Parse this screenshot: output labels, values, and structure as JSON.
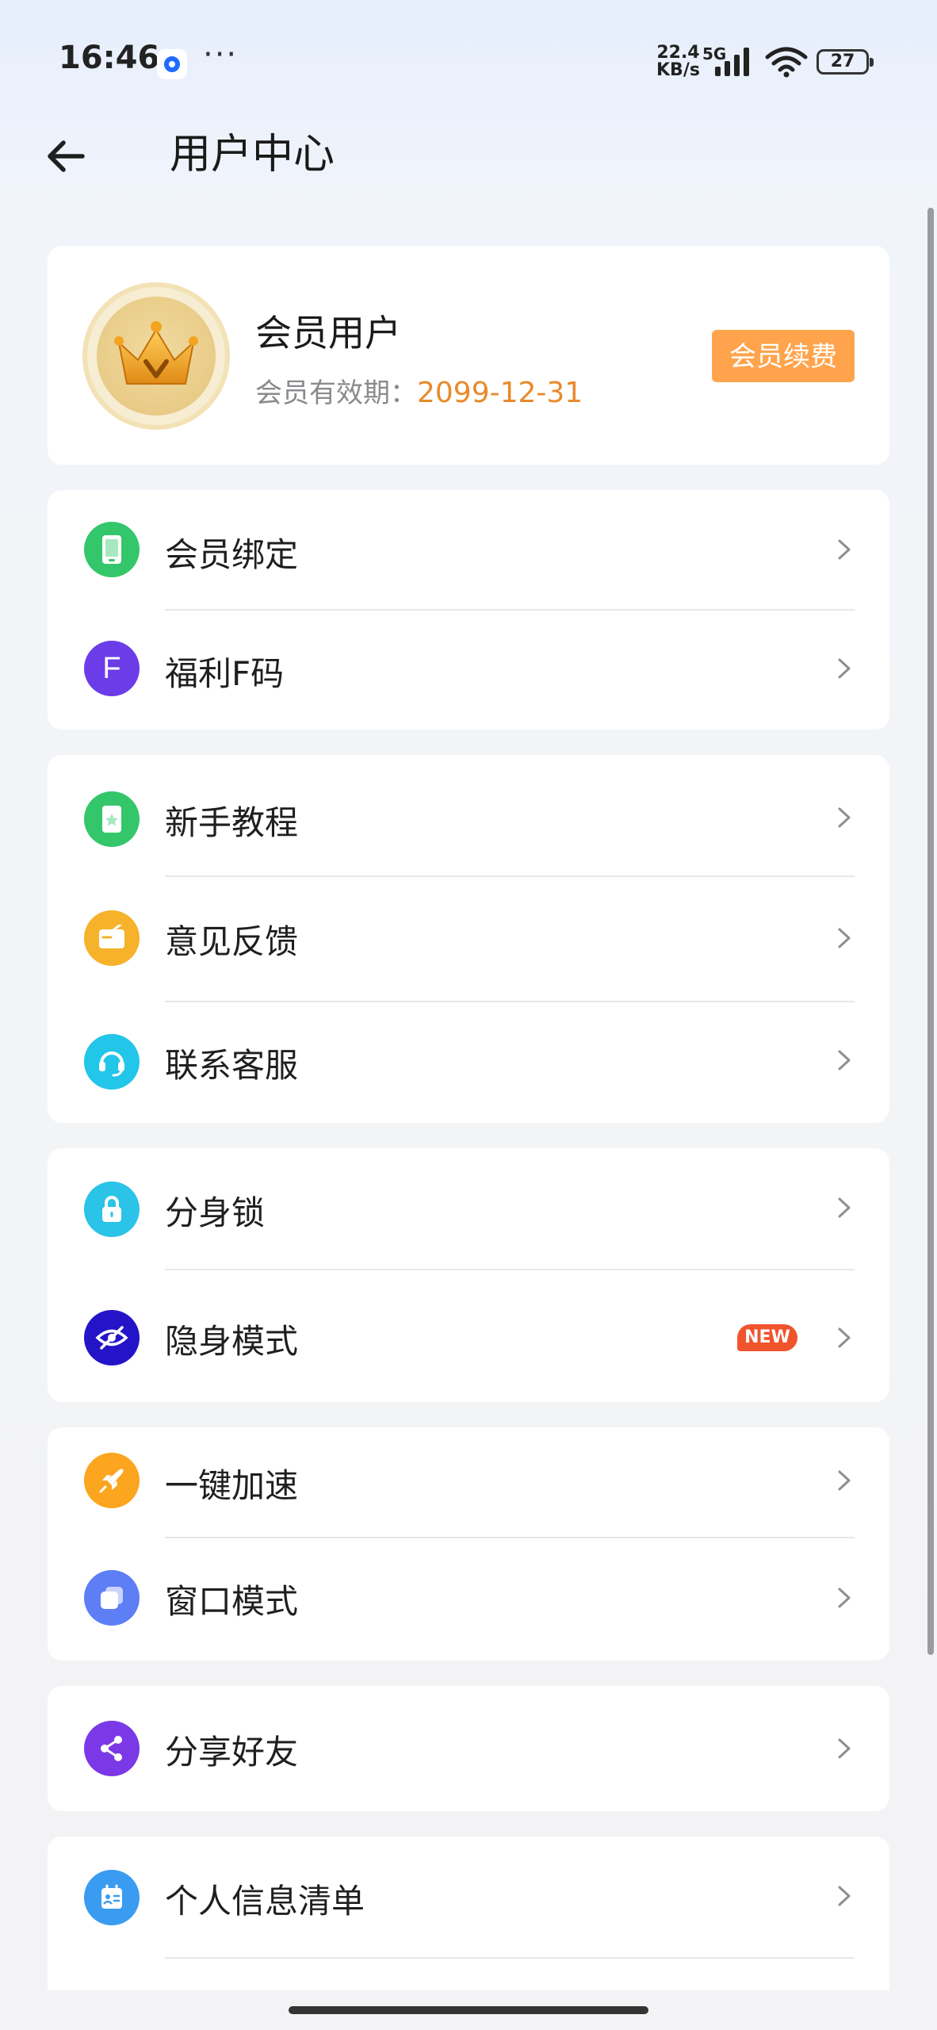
{
  "status_bar": {
    "time": "16:46",
    "more": "···",
    "net_speed_value": "22.4",
    "net_speed_unit": "KB/s",
    "network": "5G",
    "battery": "27"
  },
  "header": {
    "title": "用户中心"
  },
  "member": {
    "name": "会员用户",
    "validity_label": "会员有效期：",
    "validity_date": "2099-12-31",
    "renew_label": "会员续费"
  },
  "groups": [
    {
      "items": [
        {
          "label": "会员绑定",
          "icon": "phone-icon",
          "color": "#34c66a"
        },
        {
          "label": "福利F码",
          "icon": "letter-f-icon",
          "icon_text": "F",
          "color": "#6c3ce8"
        }
      ]
    },
    {
      "items": [
        {
          "label": "新手教程",
          "icon": "tutorial-book-icon",
          "color": "#34c66a"
        },
        {
          "label": "意见反馈",
          "icon": "feedback-envelope-icon",
          "color": "#f5b22a"
        },
        {
          "label": "联系客服",
          "icon": "headset-icon",
          "color": "#22c6e8"
        }
      ]
    },
    {
      "items": [
        {
          "label": "分身锁",
          "icon": "lock-icon",
          "color": "#2bc3e8"
        },
        {
          "label": "隐身模式",
          "icon": "eye-off-icon",
          "color": "#2414c8",
          "badge": "NEW"
        }
      ]
    },
    {
      "items": [
        {
          "label": "一键加速",
          "icon": "rocket-icon",
          "color": "#fca51e"
        },
        {
          "label": "窗口模式",
          "icon": "window-icon",
          "color": "#5e7ef5"
        }
      ]
    },
    {
      "items": [
        {
          "label": "分享好友",
          "icon": "share-icon",
          "color": "#7b38e6"
        }
      ]
    },
    {
      "items": [
        {
          "label": "个人信息清单",
          "icon": "info-list-icon",
          "color": "#3a9cf0"
        }
      ]
    }
  ],
  "colors": {
    "accent_orange": "#ffa44c",
    "date_orange": "#e88a2c",
    "new_badge": "#f0542c"
  }
}
